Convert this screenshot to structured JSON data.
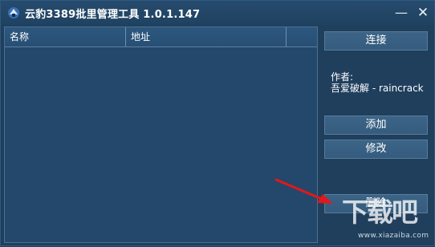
{
  "window": {
    "title": "云豹3389批里管理工具 1.0.1.147",
    "minimize_symbol": "—",
    "close_symbol": "✕"
  },
  "list": {
    "columns": [
      "名称",
      "地址",
      ""
    ]
  },
  "buttons": {
    "connect": "连接",
    "add": "添加",
    "edit": "修改",
    "delete": "删除"
  },
  "author": {
    "label": "作者:",
    "name": "吾爱破解  -  raincrack"
  },
  "watermark": {
    "main": "下载吧",
    "sub": "www.xiazaiba.com"
  },
  "colors": {
    "background": "#1f3f5d",
    "button": "#3a6184",
    "arrow": "#e0191b"
  },
  "icons": {
    "app": "app-logo-icon",
    "minimize": "minimize-icon",
    "close": "close-icon"
  }
}
